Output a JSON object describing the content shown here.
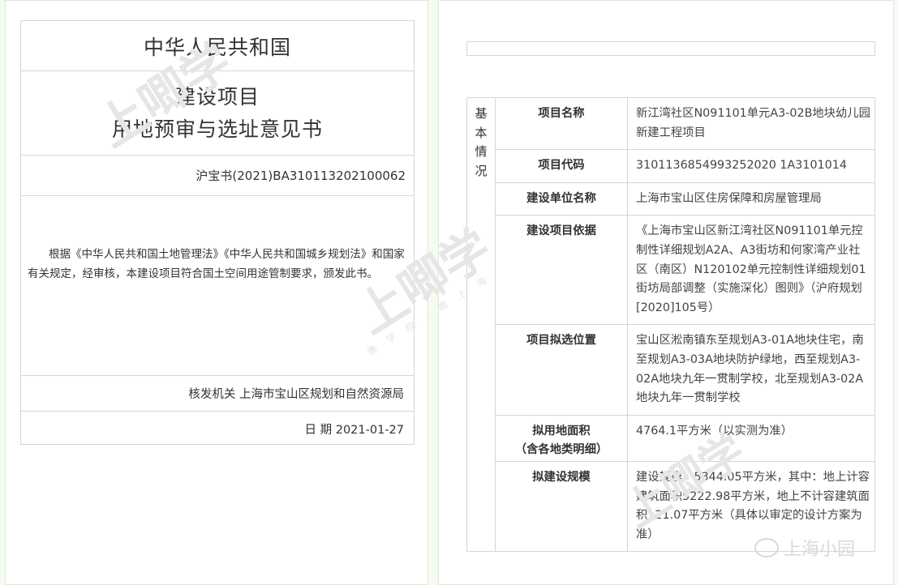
{
  "certificate": {
    "country": "中华人民共和国",
    "title_line1": "建设项目",
    "title_line2": "用地预审与选址意见书",
    "number": "沪宝书(2021)BA310113202100062",
    "body": "根据《中华人民共和国土地管理法》《中华人民共和国城乡规划法》和国家有关规定，经审核，本建设项目符合国土空间用途管制要求，颁发此书。",
    "issuer": "核发机关 上海市宝山区规划和自然资源局",
    "date": "日 期 2021-01-27"
  },
  "details": {
    "section_label": "基本情况",
    "rows": [
      {
        "label": "项目名称",
        "value": "新江湾社区N091101单元A3-02B地块幼儿园新建工程项目"
      },
      {
        "label": "项目代码",
        "value": "3101136854993252020 1A3101014"
      },
      {
        "label": "建设单位名称",
        "value": "上海市宝山区住房保障和房屋管理局"
      },
      {
        "label": "建设项目依据",
        "value": "《上海市宝山区新江湾社区N091101单元控制性详细规划A2A、A3街坊和何家湾产业社区（南区）N120102单元控制性详细规划01街坊局部调整（实施深化）图则》（沪府规划[2020]105号）"
      },
      {
        "label": "项目拟选位置",
        "value": "宝山区淞南镇东至规划A3-01A地块住宅，南至规划A3-03A地块防护绿地，西至规划A3-02A地块九年一贯制学校，北至规划A3-02A地块九年一贯制学校"
      },
      {
        "label": "拟用地面积\n（含各地类明细）",
        "value": "4764.1平方米（以实测为准）"
      },
      {
        "label": "拟建设规模",
        "value": "建设规模：5344.05平方米，其中：地上计容建筑面积5222.98平方米，地上不计容建筑面积121.07平方米（具体以审定的设计方案为准）"
      }
    ]
  },
  "watermarks": {
    "main": "上唧学",
    "sub": "唐 学 校 · 唧 上 海",
    "corner": "上海小园"
  }
}
